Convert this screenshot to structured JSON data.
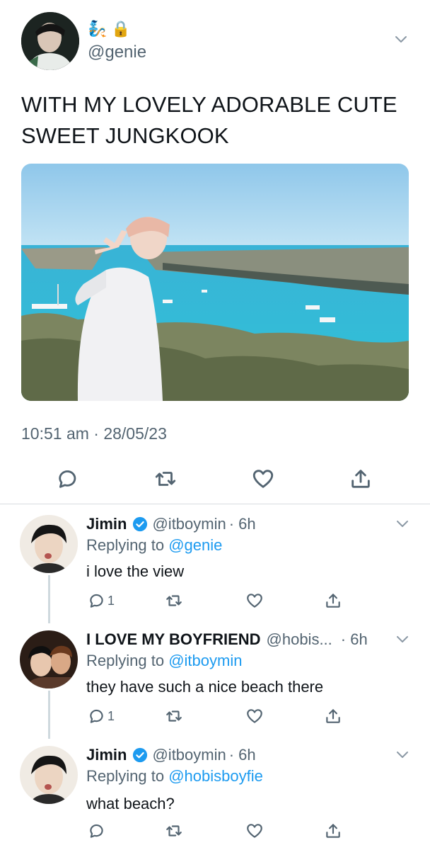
{
  "main_tweet": {
    "emojis": [
      "🧞",
      "🔒"
    ],
    "handle": "@genie",
    "text": "WITH MY LOVELY ADORABLE CUTE SWEET JUNGKOOK",
    "timestamp": "10:51 am · 28/05/23"
  },
  "replies": [
    {
      "name": "Jimin",
      "handle": "@itboymin",
      "time": "· 6h",
      "replying_prefix": "Replying to",
      "replying_to": "@genie",
      "text": "i love the view",
      "reply_count": "1"
    },
    {
      "name": "I LOVE MY BOYFRIEND",
      "handle": "@hobis...",
      "time": "· 6h",
      "replying_prefix": "Replying to",
      "replying_to": "@itboymin",
      "text": "they have such a nice beach there",
      "reply_count": "1"
    },
    {
      "name": "Jimin",
      "handle": "@itboymin",
      "time": "· 6h",
      "replying_prefix": "Replying to",
      "replying_to": "@hobisboyfie",
      "text": "what beach?",
      "reply_count": ""
    }
  ],
  "colors": {
    "link": "#1d9bf0",
    "muted": "#536471",
    "verified": "#1d9bf0",
    "divider": "#d7dbdf"
  },
  "icons": [
    "reply-icon",
    "retweet-icon",
    "like-icon",
    "share-icon",
    "chevron-down-icon",
    "verified-badge-icon"
  ]
}
